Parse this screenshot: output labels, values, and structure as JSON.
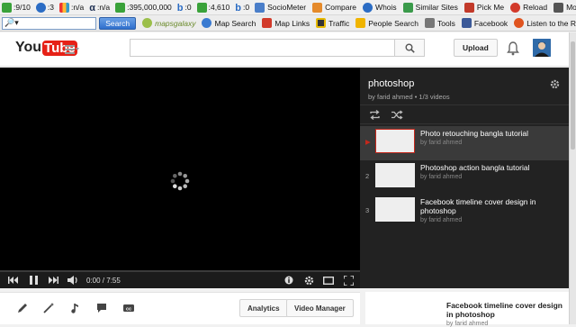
{
  "toolbar1": {
    "stats": [
      {
        "icon": "google-pagerank-icon",
        "color": "#3aa23a",
        "value": ":9/10"
      },
      {
        "icon": "link-icon",
        "color": "#2b6cc4",
        "value": ":3"
      },
      {
        "icon": "alexa-chart-icon",
        "color": "#e33",
        "value": ":n/a"
      },
      {
        "icon": "alpha-icon",
        "color": "#235",
        "value": ":n/a"
      },
      {
        "icon": "google-index-icon",
        "color": "#3aa23a",
        "value": ":395,000,000"
      },
      {
        "icon": "bing-icon",
        "color": "#2b6cc4",
        "value": ":0"
      },
      {
        "icon": "google-links-icon",
        "color": "#3aa23a",
        "value": ":4,610"
      },
      {
        "icon": "bing-links-icon",
        "color": "#2b6cc4",
        "value": ":0"
      }
    ],
    "tools": [
      {
        "icon": "sociometer-icon",
        "label": "SocioMeter"
      },
      {
        "icon": "compare-icon",
        "label": "Compare"
      },
      {
        "icon": "whois-icon",
        "label": "Whois"
      },
      {
        "icon": "similar-sites-icon",
        "label": "Similar Sites"
      },
      {
        "icon": "pick-me-icon",
        "label": "Pick Me"
      },
      {
        "icon": "reload-icon",
        "label": "Reload"
      },
      {
        "icon": "more-icon",
        "label": "More"
      }
    ]
  },
  "toolbar2": {
    "search_placeholder": "",
    "search_glyph": "🔎▾",
    "search_button": "Search",
    "items": [
      {
        "icon": "mapsgalaxy-icon",
        "label": "mapsgalaxy"
      },
      {
        "icon": "map-search-icon",
        "label": "Map Search"
      },
      {
        "icon": "map-links-icon",
        "label": "Map Links"
      },
      {
        "icon": "traffic-icon",
        "label": "Traffic"
      },
      {
        "icon": "people-search-icon",
        "label": "People Search"
      },
      {
        "icon": "tools-icon",
        "label": "Tools"
      },
      {
        "icon": "facebook-icon",
        "label": "Facebook"
      },
      {
        "icon": "radio-icon",
        "label": "Listen to the R"
      }
    ]
  },
  "header": {
    "logo_you": "You",
    "logo_tube": "Tube",
    "search_placeholder": "",
    "upload_label": "Upload"
  },
  "player": {
    "time": "0:00 / 7:55"
  },
  "playlist": {
    "title": "photoshop",
    "subtitle": "by farid ahmed • 1/3 videos",
    "items": [
      {
        "index": "▶",
        "title": "Photo retouching bangla tutorial",
        "author": "by farid ahmed",
        "active": true
      },
      {
        "index": "2",
        "title": "Photoshop action bangla tutorial",
        "author": "by farid ahmed",
        "active": false
      },
      {
        "index": "3",
        "title": "Facebook timeline cover design in photoshop",
        "author": "by farid ahmed",
        "active": false
      }
    ]
  },
  "actions": {
    "analytics_label": "Analytics",
    "video_manager_label": "Video Manager"
  },
  "sidecard": {
    "title": "Facebook timeline cover design in photoshop",
    "author": "by farid ahmed"
  },
  "colors": {
    "youtube_red": "#e62117",
    "playlist_bg": "#222222",
    "active_thumb_border": "#c5281c"
  }
}
